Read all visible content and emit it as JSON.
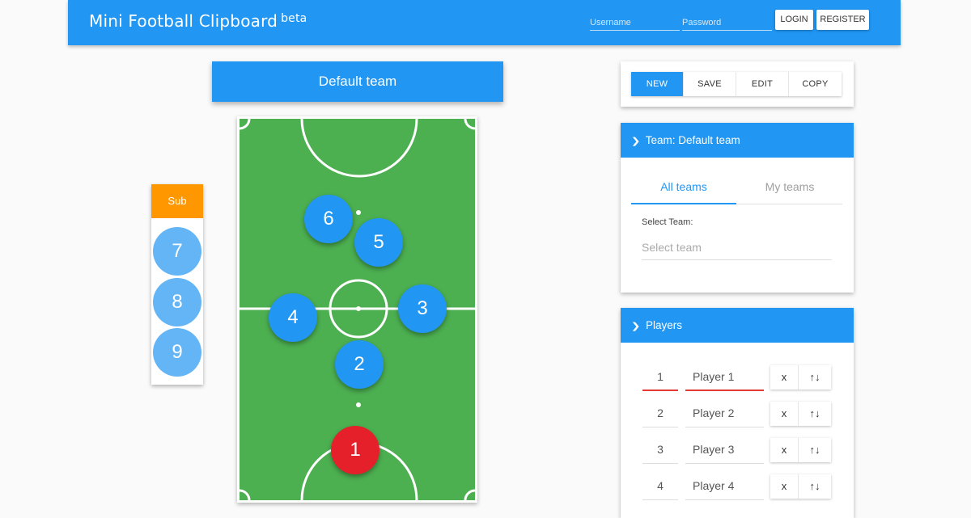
{
  "header": {
    "brand": "Mini Football Clipboard",
    "brand_tag": "beta",
    "username_placeholder": "Username",
    "password_placeholder": "Password",
    "login_label": "LOGIN",
    "register_label": "REGISTER"
  },
  "team_banner": "Default team",
  "sub": {
    "label": "Sub",
    "players": [
      "7",
      "8",
      "9"
    ]
  },
  "pitch": {
    "players": [
      "1",
      "2",
      "3",
      "4",
      "5",
      "6"
    ]
  },
  "toolbar": {
    "buttons": [
      "NEW",
      "SAVE",
      "EDIT",
      "COPY"
    ]
  },
  "team_panel": {
    "title": "Team: Default team",
    "tabs": [
      "All teams",
      "My teams"
    ],
    "select_label": "Select Team:",
    "select_placeholder": "Select team"
  },
  "players_panel": {
    "title": "Players",
    "rows": [
      {
        "num": "1",
        "name": "Player 1"
      },
      {
        "num": "2",
        "name": "Player 2"
      },
      {
        "num": "3",
        "name": "Player 3"
      },
      {
        "num": "4",
        "name": "Player 4"
      }
    ],
    "remove_label": "x",
    "swap_label": "↑↓"
  },
  "colors": {
    "primary": "#2196f3",
    "sub_header": "#ff9800",
    "pitch": "#4caf50",
    "goalkeeper": "#e5202a",
    "sub_player": "#64b5f6"
  }
}
